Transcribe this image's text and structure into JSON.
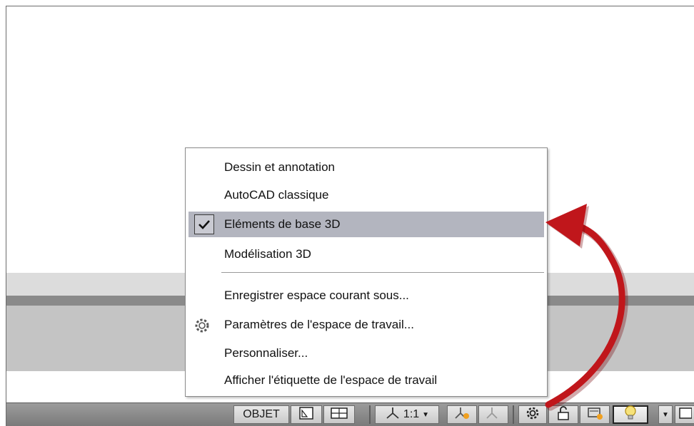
{
  "menu": {
    "items": [
      {
        "label": "Dessin et annotation"
      },
      {
        "label": "AutoCAD classique"
      },
      {
        "label": "Eléments de base 3D",
        "checked": true
      },
      {
        "label": "Modélisation 3D"
      },
      {
        "label": "Enregistrer espace courant sous..."
      },
      {
        "label": "Paramètres de l'espace de travail...",
        "icon": "gear-icon"
      },
      {
        "label": "Personnaliser..."
      },
      {
        "label": "Afficher l'étiquette de l'espace de travail"
      }
    ]
  },
  "statusbar": {
    "object_label": "OBJET",
    "scale_label": "1:1"
  },
  "colors": {
    "selection": "#b3b5bf",
    "arrow": "#c0161b"
  }
}
